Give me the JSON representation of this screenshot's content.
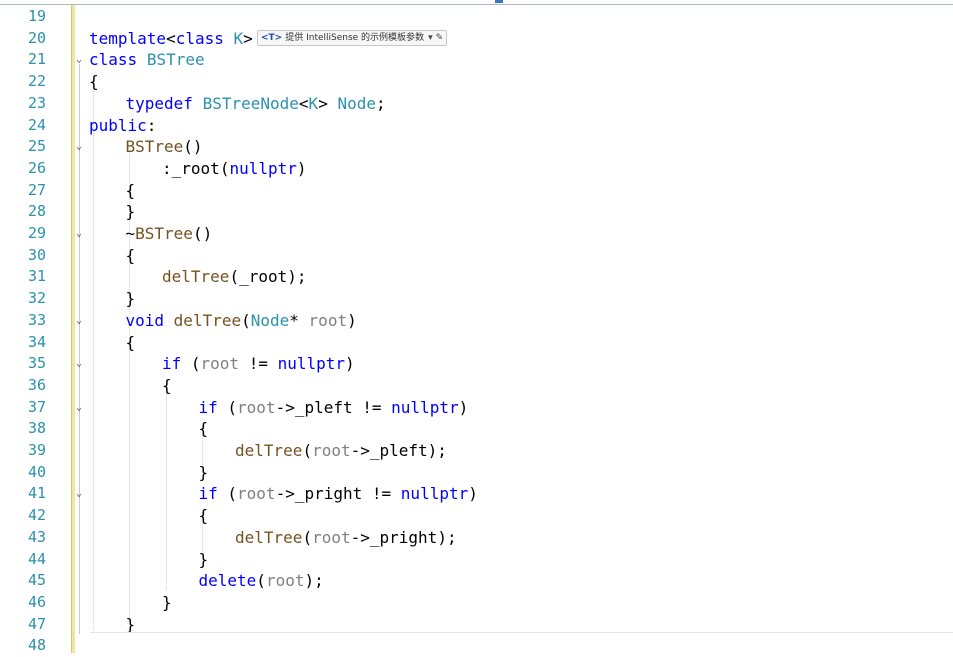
{
  "editor": {
    "colors": {
      "line_number": "#2b91af",
      "keyword": "#0000ff",
      "type": "#2b91af",
      "function": "#74531f",
      "parameter": "#808080",
      "plain": "#000000",
      "modified_gutter": "#f1e5a0"
    },
    "intellisense_hint": {
      "tag": "<T>",
      "text": "提供 IntelliSense 的示例模板参数",
      "dropdown_icon": "chevron-down-icon",
      "edit_icon": "pencil-icon"
    },
    "lines": [
      {
        "num": "19",
        "fold": "",
        "indent": 0,
        "tokens": []
      },
      {
        "num": "20",
        "fold": "",
        "indent": 0,
        "tokens": [
          {
            "t": "template",
            "c": "keyword"
          },
          {
            "t": "<",
            "c": "plain"
          },
          {
            "t": "class",
            "c": "keyword"
          },
          {
            "t": " ",
            "c": "plain"
          },
          {
            "t": "K",
            "c": "type"
          },
          {
            "t": ">",
            "c": "plain"
          }
        ]
      },
      {
        "num": "21",
        "fold": "⌄",
        "indent": 0,
        "tokens": [
          {
            "t": "class",
            "c": "keyword"
          },
          {
            "t": " ",
            "c": "plain"
          },
          {
            "t": "BSTree",
            "c": "type"
          }
        ]
      },
      {
        "num": "22",
        "fold": "",
        "indent": 0,
        "tokens": [
          {
            "t": "{",
            "c": "plain"
          }
        ]
      },
      {
        "num": "23",
        "fold": "",
        "indent": 1,
        "tokens": [
          {
            "t": "typedef",
            "c": "keyword"
          },
          {
            "t": " ",
            "c": "plain"
          },
          {
            "t": "BSTreeNode",
            "c": "type"
          },
          {
            "t": "<",
            "c": "plain"
          },
          {
            "t": "K",
            "c": "type"
          },
          {
            "t": "> ",
            "c": "plain"
          },
          {
            "t": "Node",
            "c": "type"
          },
          {
            "t": ";",
            "c": "plain"
          }
        ]
      },
      {
        "num": "24",
        "fold": "",
        "indent": 0,
        "tokens": [
          {
            "t": "public",
            "c": "keyword"
          },
          {
            "t": ":",
            "c": "plain"
          }
        ]
      },
      {
        "num": "25",
        "fold": "⌄",
        "indent": 1,
        "tokens": [
          {
            "t": "BSTree",
            "c": "function"
          },
          {
            "t": "()",
            "c": "plain"
          }
        ]
      },
      {
        "num": "26",
        "fold": "",
        "indent": 2,
        "tokens": [
          {
            "t": ":",
            "c": "plain"
          },
          {
            "t": "_root",
            "c": "plain"
          },
          {
            "t": "(",
            "c": "plain"
          },
          {
            "t": "nullptr",
            "c": "keyword"
          },
          {
            "t": ")",
            "c": "plain"
          }
        ]
      },
      {
        "num": "27",
        "fold": "",
        "indent": 1,
        "tokens": [
          {
            "t": "{",
            "c": "plain"
          }
        ]
      },
      {
        "num": "28",
        "fold": "",
        "indent": 1,
        "tokens": [
          {
            "t": "}",
            "c": "plain"
          }
        ]
      },
      {
        "num": "29",
        "fold": "⌄",
        "indent": 1,
        "tokens": [
          {
            "t": "~",
            "c": "plain"
          },
          {
            "t": "BSTree",
            "c": "function"
          },
          {
            "t": "()",
            "c": "plain"
          }
        ]
      },
      {
        "num": "30",
        "fold": "",
        "indent": 1,
        "tokens": [
          {
            "t": "{",
            "c": "plain"
          }
        ]
      },
      {
        "num": "31",
        "fold": "",
        "indent": 2,
        "tokens": [
          {
            "t": "delTree",
            "c": "function"
          },
          {
            "t": "(",
            "c": "plain"
          },
          {
            "t": "_root",
            "c": "plain"
          },
          {
            "t": ");",
            "c": "plain"
          }
        ]
      },
      {
        "num": "32",
        "fold": "",
        "indent": 1,
        "tokens": [
          {
            "t": "}",
            "c": "plain"
          }
        ]
      },
      {
        "num": "33",
        "fold": "⌄",
        "indent": 1,
        "tokens": [
          {
            "t": "void",
            "c": "keyword"
          },
          {
            "t": " ",
            "c": "plain"
          },
          {
            "t": "delTree",
            "c": "function"
          },
          {
            "t": "(",
            "c": "plain"
          },
          {
            "t": "Node",
            "c": "type"
          },
          {
            "t": "* ",
            "c": "plain"
          },
          {
            "t": "root",
            "c": "parameter"
          },
          {
            "t": ")",
            "c": "plain"
          }
        ]
      },
      {
        "num": "34",
        "fold": "",
        "indent": 1,
        "tokens": [
          {
            "t": "{",
            "c": "plain"
          }
        ]
      },
      {
        "num": "35",
        "fold": "⌄",
        "indent": 2,
        "tokens": [
          {
            "t": "if",
            "c": "keyword"
          },
          {
            "t": " (",
            "c": "plain"
          },
          {
            "t": "root",
            "c": "parameter"
          },
          {
            "t": " != ",
            "c": "plain"
          },
          {
            "t": "nullptr",
            "c": "keyword"
          },
          {
            "t": ")",
            "c": "plain"
          }
        ]
      },
      {
        "num": "36",
        "fold": "",
        "indent": 2,
        "tokens": [
          {
            "t": "{",
            "c": "plain"
          }
        ]
      },
      {
        "num": "37",
        "fold": "⌄",
        "indent": 3,
        "tokens": [
          {
            "t": "if",
            "c": "keyword"
          },
          {
            "t": " (",
            "c": "plain"
          },
          {
            "t": "root",
            "c": "parameter"
          },
          {
            "t": "->",
            "c": "plain"
          },
          {
            "t": "_pleft",
            "c": "plain"
          },
          {
            "t": " != ",
            "c": "plain"
          },
          {
            "t": "nullptr",
            "c": "keyword"
          },
          {
            "t": ")",
            "c": "plain"
          }
        ]
      },
      {
        "num": "38",
        "fold": "",
        "indent": 3,
        "tokens": [
          {
            "t": "{",
            "c": "plain"
          }
        ]
      },
      {
        "num": "39",
        "fold": "",
        "indent": 4,
        "tokens": [
          {
            "t": "delTree",
            "c": "function"
          },
          {
            "t": "(",
            "c": "plain"
          },
          {
            "t": "root",
            "c": "parameter"
          },
          {
            "t": "->",
            "c": "plain"
          },
          {
            "t": "_pleft",
            "c": "plain"
          },
          {
            "t": ");",
            "c": "plain"
          }
        ]
      },
      {
        "num": "40",
        "fold": "",
        "indent": 3,
        "tokens": [
          {
            "t": "}",
            "c": "plain"
          }
        ]
      },
      {
        "num": "41",
        "fold": "⌄",
        "indent": 3,
        "tokens": [
          {
            "t": "if",
            "c": "keyword"
          },
          {
            "t": " (",
            "c": "plain"
          },
          {
            "t": "root",
            "c": "parameter"
          },
          {
            "t": "->",
            "c": "plain"
          },
          {
            "t": "_pright",
            "c": "plain"
          },
          {
            "t": " != ",
            "c": "plain"
          },
          {
            "t": "nullptr",
            "c": "keyword"
          },
          {
            "t": ")",
            "c": "plain"
          }
        ]
      },
      {
        "num": "42",
        "fold": "",
        "indent": 3,
        "tokens": [
          {
            "t": "{",
            "c": "plain"
          }
        ]
      },
      {
        "num": "43",
        "fold": "",
        "indent": 4,
        "tokens": [
          {
            "t": "delTree",
            "c": "function"
          },
          {
            "t": "(",
            "c": "plain"
          },
          {
            "t": "root",
            "c": "parameter"
          },
          {
            "t": "->",
            "c": "plain"
          },
          {
            "t": "_pright",
            "c": "plain"
          },
          {
            "t": ");",
            "c": "plain"
          }
        ]
      },
      {
        "num": "44",
        "fold": "",
        "indent": 3,
        "tokens": [
          {
            "t": "}",
            "c": "plain"
          }
        ]
      },
      {
        "num": "45",
        "fold": "",
        "indent": 3,
        "tokens": [
          {
            "t": "delete",
            "c": "keyword"
          },
          {
            "t": "(",
            "c": "plain"
          },
          {
            "t": "root",
            "c": "parameter"
          },
          {
            "t": ");",
            "c": "plain"
          }
        ]
      },
      {
        "num": "46",
        "fold": "",
        "indent": 2,
        "tokens": [
          {
            "t": "}",
            "c": "plain"
          }
        ]
      },
      {
        "num": "47",
        "fold": "",
        "indent": 1,
        "tokens": [
          {
            "t": "}",
            "c": "plain"
          }
        ]
      },
      {
        "num": "48",
        "fold": "",
        "indent": 0,
        "tokens": []
      }
    ]
  }
}
